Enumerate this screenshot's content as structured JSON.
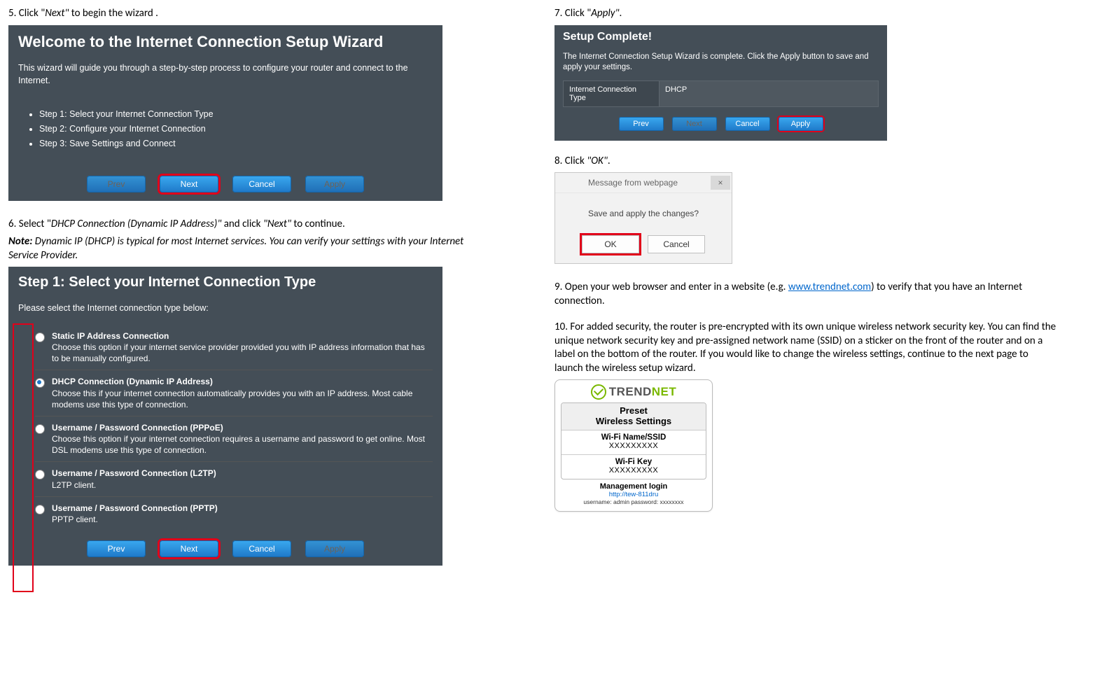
{
  "left": {
    "step5": {
      "num": "5.",
      "pre": "Click \"",
      "em": "Next\"",
      "post": " to begin the wizard ."
    },
    "wizard1": {
      "title": "Welcome to the Internet Connection Setup Wizard",
      "desc": "This wizard will guide you through a step-by-step process to configure your router and connect to the Internet.",
      "steps": [
        "Step 1: Select your Internet Connection Type",
        "Step 2: Configure your Internet Connection",
        "Step 3: Save Settings and Connect"
      ],
      "btns": {
        "prev": "Prev",
        "next": "Next",
        "cancel": "Cancel",
        "apply": "Apply"
      }
    },
    "step6": {
      "num": "6.",
      "pre": "Select \"",
      "em1": "DHCP Connection (Dynamic IP Address)\"",
      "mid": " and click ",
      "em2": "\"Next\"",
      "post": " to continue."
    },
    "note": {
      "label": "Note:",
      "text": "Dynamic IP (DHCP) is typical for most Internet services. You can verify your settings with your Internet Service Provider."
    },
    "wizard2": {
      "title": "Step 1: Select your Internet Connection Type",
      "desc": "Please select the Internet connection type below:",
      "options": [
        {
          "title": "Static IP Address Connection",
          "desc": "Choose this option if your internet service provider provided you with IP address information that has to be manually configured.",
          "sel": false
        },
        {
          "title": "DHCP Connection (Dynamic IP Address)",
          "desc": "Choose this if your internet connection automatically provides you with an IP address. Most cable modems use this type of connection.",
          "sel": true
        },
        {
          "title": "Username / Password Connection (PPPoE)",
          "desc": "Choose this option if your internet connection requires a username and password to get online. Most DSL modems use this type of connection.",
          "sel": false
        },
        {
          "title": "Username / Password Connection (L2TP)",
          "desc": "L2TP client.",
          "sel": false
        },
        {
          "title": "Username / Password Connection (PPTP)",
          "desc": "PPTP client.",
          "sel": false
        }
      ],
      "btns": {
        "prev": "Prev",
        "next": "Next",
        "cancel": "Cancel",
        "apply": "Apply"
      }
    }
  },
  "right": {
    "step7": {
      "num": "7.",
      "pre": "Click \"",
      "em": "Apply\"",
      "post": "."
    },
    "complete": {
      "title": "Setup Complete!",
      "desc": "The Internet Connection Setup Wizard is complete. Click the Apply button to save and apply your settings.",
      "info_label": "Internet Connection Type",
      "info_val": "DHCP",
      "btns": {
        "prev": "Prev",
        "next": "Next",
        "cancel": "Cancel",
        "apply": "Apply"
      }
    },
    "step8": {
      "num": "8.",
      "pre": "Click ",
      "em": "\"OK\"",
      "post": "."
    },
    "dialog": {
      "title": "Message from webpage",
      "body": "Save and apply the changes?",
      "ok": "OK",
      "cancel": "Cancel",
      "close": "×"
    },
    "step9": {
      "num": "9.",
      "pre": "Open your web browser and enter in a website (e.g. ",
      "link": "www.trendnet.com",
      "post": ") to verify that you have an Internet connection."
    },
    "step10": {
      "num": "10.",
      "text": "For added security, the router is pre-encrypted with its own unique wireless network security key. You can find the unique network security key and pre-assigned network name (SSID) on a sticker on the front of the router and on a label on the bottom of the router. If you would like to change the wireless settings, continue to the next page to launch the wireless setup wizard."
    },
    "sticker": {
      "brand_a": "TREND",
      "brand_b": "NET",
      "preset_head": "Preset\nWireless Settings",
      "name_label": "Wi-Fi Name/SSID",
      "name_val": "XXXXXXXXX",
      "key_label": "Wi-Fi Key",
      "key_val": "XXXXXXXXX",
      "mgmt_title": "Management login",
      "mgmt_url": "http://tew-811dru",
      "mgmt_cred": "username: admin   password: xxxxxxxx"
    }
  }
}
